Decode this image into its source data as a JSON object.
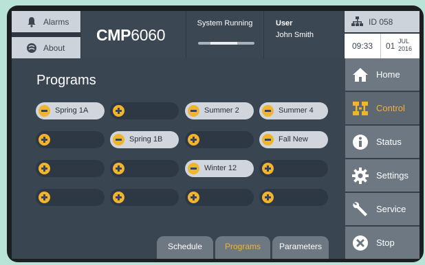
{
  "header": {
    "alarms_label": "Alarms",
    "about_label": "About",
    "brand_bold": "CMP",
    "brand_light": "6060",
    "status_label": "System Running",
    "user_heading": "User",
    "user_name": "John Smith",
    "device_id": "ID 058",
    "time": "09:33",
    "day": "01",
    "month": "JUL",
    "year": "2016"
  },
  "main": {
    "title": "Programs",
    "programs": [
      {
        "label": "Spring 1A",
        "state": "assigned"
      },
      {
        "label": "",
        "state": "empty"
      },
      {
        "label": "Summer 2",
        "state": "assigned"
      },
      {
        "label": "Summer 4",
        "state": "assigned"
      },
      {
        "label": "",
        "state": "empty"
      },
      {
        "label": "Spring 1B",
        "state": "assigned"
      },
      {
        "label": "",
        "state": "empty"
      },
      {
        "label": "Fall New",
        "state": "assigned"
      },
      {
        "label": "",
        "state": "empty"
      },
      {
        "label": "",
        "state": "empty"
      },
      {
        "label": "Winter 12",
        "state": "assigned"
      },
      {
        "label": "",
        "state": "empty"
      },
      {
        "label": "",
        "state": "empty"
      },
      {
        "label": "",
        "state": "empty"
      },
      {
        "label": "",
        "state": "empty"
      },
      {
        "label": "",
        "state": "empty"
      }
    ]
  },
  "tabs": {
    "schedule": "Schedule",
    "programs": "Programs",
    "parameters": "Parameters",
    "active": "programs"
  },
  "nav": {
    "items": [
      {
        "label": "Home",
        "icon": "home-icon"
      },
      {
        "label": "Control",
        "icon": "control-icon",
        "active": true
      },
      {
        "label": "Status",
        "icon": "info-icon"
      },
      {
        "label": "Settings",
        "icon": "gear-icon"
      },
      {
        "label": "Service",
        "icon": "wrench-icon"
      },
      {
        "label": "Stop",
        "icon": "stop-icon"
      }
    ]
  },
  "colors": {
    "accent": "#f2b42a",
    "screen_bg": "#3a4552",
    "nav_button": "#6d7883"
  }
}
